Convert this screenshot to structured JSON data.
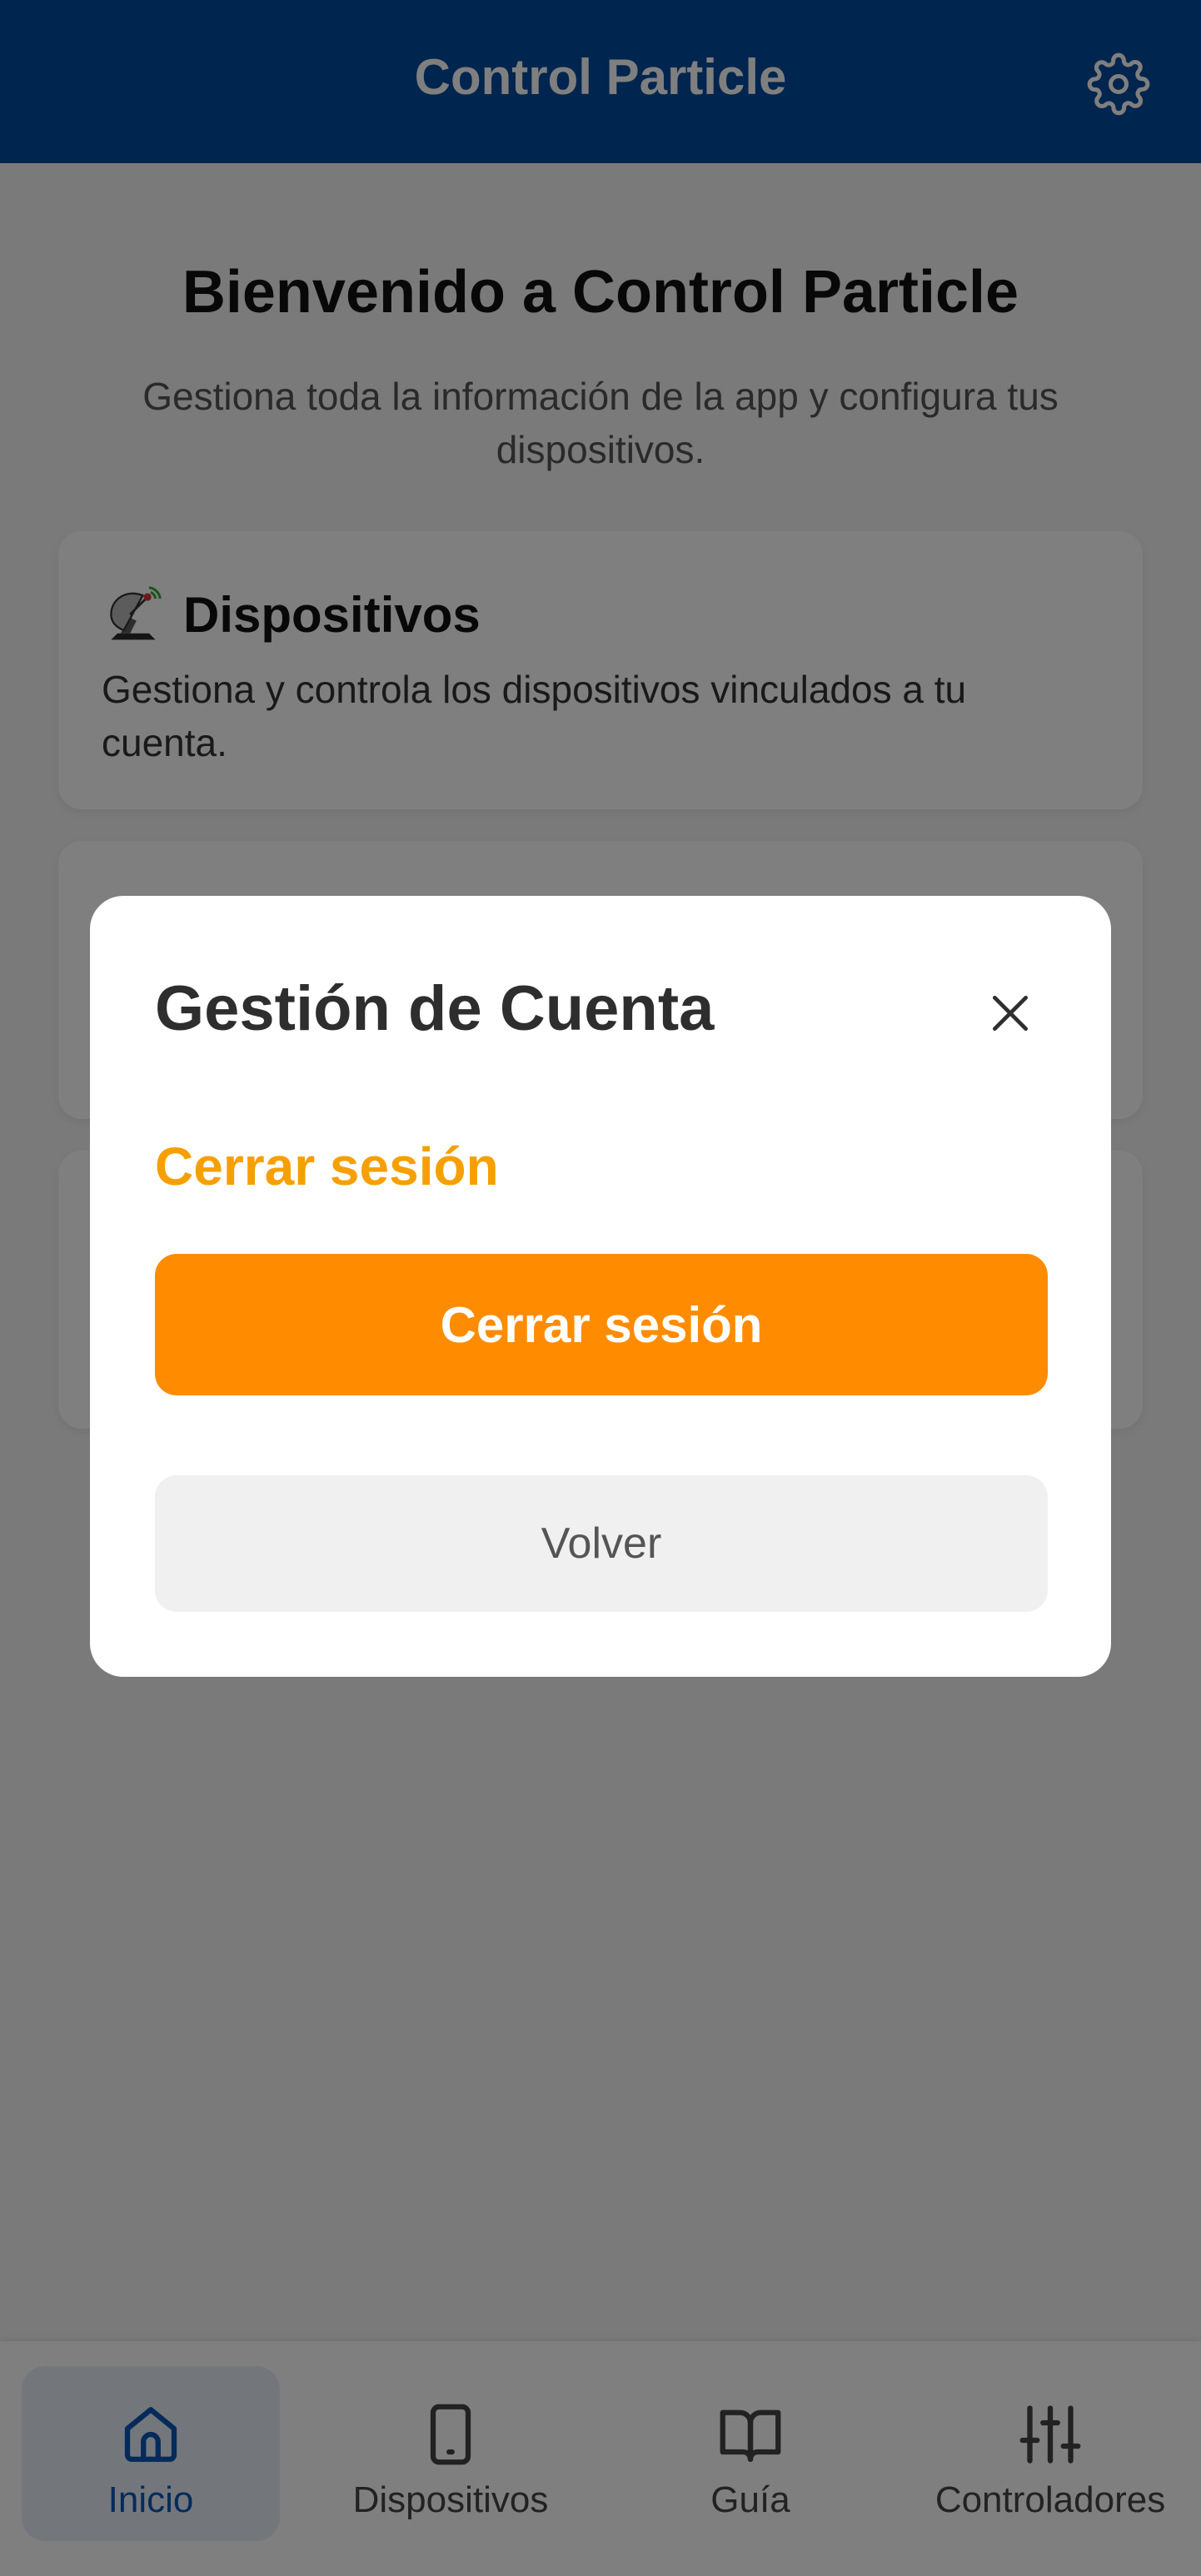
{
  "header": {
    "title": "Control Particle",
    "settings_icon": "gear-icon"
  },
  "main": {
    "title": "Bienvenido a Control Particle",
    "subtitle": "Gestiona toda la información de la app y configura tus dispositivos.",
    "cards": [
      {
        "icon": "satellite-dish-icon",
        "title": "Dispositivos",
        "description": "Gestiona y controla los dispositivos vinculados a tu cuenta."
      },
      {
        "icon": "card-icon",
        "title": "",
        "description": ""
      },
      {
        "icon": "",
        "title": "",
        "description": ""
      }
    ]
  },
  "modal": {
    "title": "Gestión de Cuenta",
    "close_icon": "close-icon",
    "section_title": "Cerrar sesión",
    "primary_button": "Cerrar sesión",
    "secondary_button": "Volver"
  },
  "bottom_nav": {
    "items": [
      {
        "label": "Inicio",
        "icon": "home-icon",
        "active": true
      },
      {
        "label": "Dispositivos",
        "icon": "tablet-icon",
        "active": false
      },
      {
        "label": "Guía",
        "icon": "book-icon",
        "active": false
      },
      {
        "label": "Controladores",
        "icon": "sliders-icon",
        "active": false
      }
    ]
  },
  "colors": {
    "header_bg": "#004a9f",
    "accent_orange": "#ff8c00",
    "section_title": "#f5a000",
    "nav_active": "#0a56b5"
  }
}
